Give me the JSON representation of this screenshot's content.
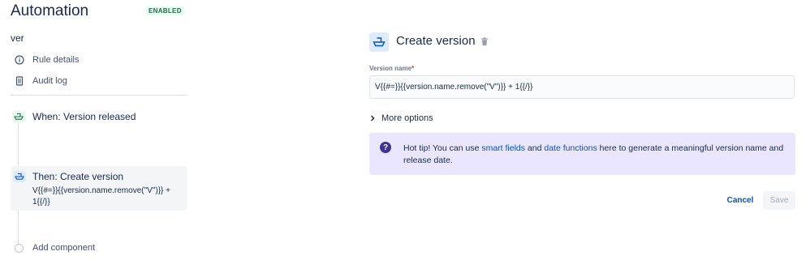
{
  "header": {
    "title": "Automation",
    "status_badge": "ENABLED"
  },
  "sidebar": {
    "rule_name": "ver",
    "nav": [
      {
        "label": "Rule details",
        "icon": "info-icon"
      },
      {
        "label": "Audit log",
        "icon": "document-icon"
      }
    ],
    "components": {
      "trigger": {
        "label": "When: Version released",
        "icon": "ship-icon"
      },
      "action": {
        "label": "Then: Create version",
        "detail": "V{{#=}}{{version.name.remove(\"V\")}} + 1{{/}}",
        "icon": "ship-icon"
      },
      "add_label": "Add component"
    }
  },
  "panel": {
    "title": "Create version",
    "field_label": "Version name",
    "required_marker": "*",
    "version_value": "V{{#=}}{{version.name.remove(\"V\")}} + 1{{/}}",
    "more_options": "More options",
    "tip": {
      "prefix": "Hot tip! You can use ",
      "link1": "smart fields",
      "middle": " and ",
      "link2": "date functions",
      "suffix": " here to generate a meaningful version name and release date."
    },
    "cancel_label": "Cancel",
    "save_label": "Save"
  },
  "colors": {
    "accent": "#0052cc",
    "tip_background": "#eae6ff",
    "enabled_badge": "#216e4e",
    "selected_card": "#f4f5f7"
  }
}
